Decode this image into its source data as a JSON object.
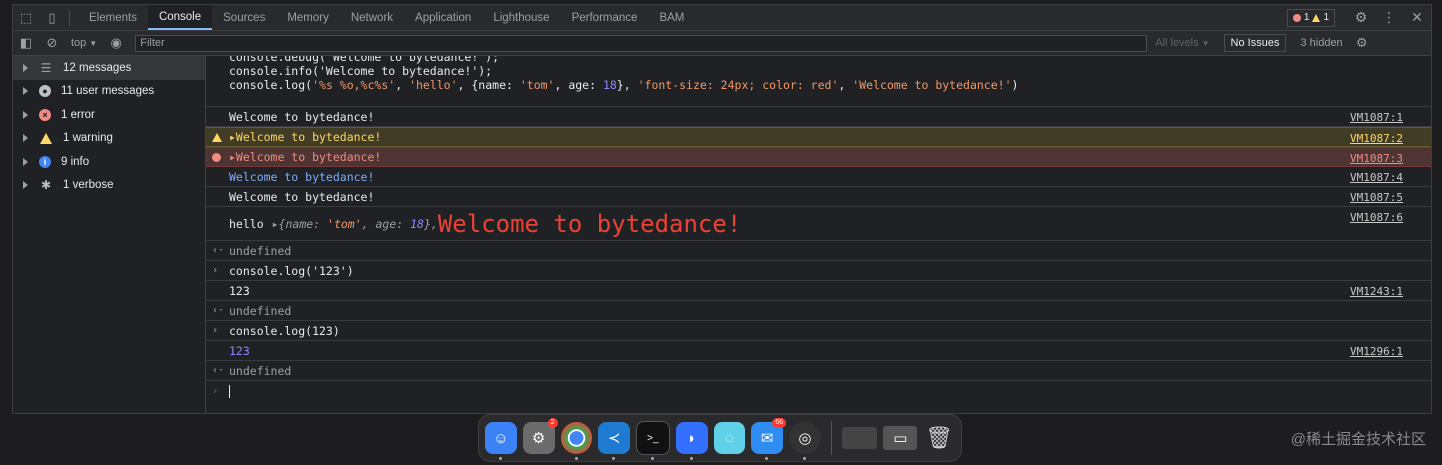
{
  "tabs": [
    {
      "label": "Elements",
      "active": false
    },
    {
      "label": "Console",
      "active": true
    },
    {
      "label": "Sources",
      "active": false
    },
    {
      "label": "Memory",
      "active": false
    },
    {
      "label": "Network",
      "active": false
    },
    {
      "label": "Application",
      "active": false
    },
    {
      "label": "Lighthouse",
      "active": false
    },
    {
      "label": "Performance",
      "active": false
    },
    {
      "label": "BAM",
      "active": false
    }
  ],
  "badges": {
    "errors": "1",
    "warnings": "1"
  },
  "toolbar": {
    "context": "top",
    "filter_placeholder": "Filter",
    "levels": "All levels",
    "issues": "No Issues",
    "hidden": "3 hidden"
  },
  "sidebar": [
    {
      "label": "12 messages",
      "icon": "list-icon"
    },
    {
      "label": "11 user messages",
      "icon": "user-icon"
    },
    {
      "label": "1 error",
      "icon": "error-icon"
    },
    {
      "label": "1 warning",
      "icon": "warning-icon"
    },
    {
      "label": "9 info",
      "icon": "info-icon"
    },
    {
      "label": "1 verbose",
      "icon": "bug-icon"
    }
  ],
  "console": {
    "input_lines": [
      "console.debug('Welcome to bytedance!');",
      "console.info('Welcome to bytedance!');"
    ],
    "log_call": {
      "head": "console.log(",
      "fmt": "'%s %o,%c%s'",
      "a1": "'hello'",
      "obj_open": "{name: ",
      "name_val": "'tom'",
      "age_key": ", age: ",
      "age_val": "18",
      "obj_close": "}",
      "a3": "'font-size: 24px; color: red'",
      "a4": "'Welcome to bytedance!'",
      "tail": ")"
    },
    "rows": [
      {
        "text": "Welcome to bytedance!",
        "src": "VM1087:1"
      },
      {
        "text": "▸Welcome to bytedance!",
        "src": "VM1087:2"
      },
      {
        "text": "▸Welcome to bytedance!",
        "src": "VM1087:3"
      },
      {
        "text": "Welcome to bytedance!",
        "src": "VM1087:4"
      },
      {
        "text": "Welcome to bytedance!",
        "src": "VM1087:5"
      }
    ],
    "styled": {
      "hello": "hello",
      "obj_prefix": "▸{name: ",
      "name_val": "'tom'",
      "age_key": ", age: ",
      "age_val": "18",
      "obj_suffix": "},",
      "big": "Welcome to bytedance!",
      "src": "VM1087:6"
    },
    "undefined": "undefined",
    "cmd1": "console.log('123')",
    "out1": "123",
    "out1_src": "VM1243:1",
    "cmd2": "console.log(123)",
    "out2": "123",
    "out2_src": "VM1296:1"
  },
  "dock": {
    "apps": [
      {
        "name": "finder",
        "color": "#3b82f6",
        "badge": ""
      },
      {
        "name": "system-preferences",
        "color": "#6b6b6b",
        "badge": "2"
      },
      {
        "name": "chrome",
        "color": "#34a853",
        "badge": ""
      },
      {
        "name": "vscode",
        "color": "#1f7bd1",
        "badge": ""
      },
      {
        "name": "terminal",
        "color": "#111111",
        "badge": ""
      },
      {
        "name": "feishu",
        "color": "#3370ff",
        "badge": ""
      },
      {
        "name": "app-c",
        "color": "#5fd0e8",
        "badge": ""
      },
      {
        "name": "mail",
        "color": "#2f8cf0",
        "badge": "66"
      },
      {
        "name": "obs",
        "color": "#333333",
        "badge": ""
      }
    ]
  },
  "watermark": "@稀土掘金技术社区"
}
